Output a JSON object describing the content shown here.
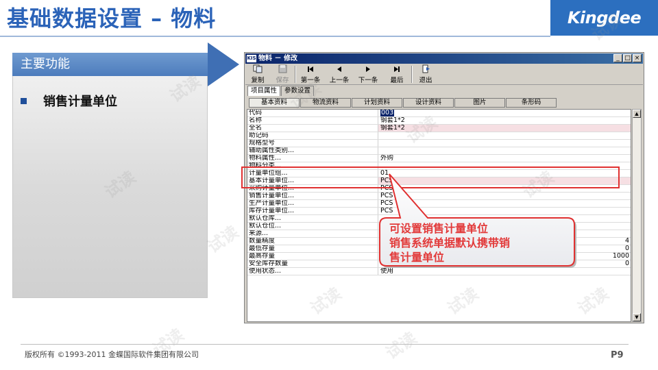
{
  "slide": {
    "title": "基础数据设置 – 物料",
    "logo": "Kingdee",
    "panel_heading": "主要功能",
    "bullet": "销售计量单位",
    "watermark": "试读",
    "copyright": "版权所有 ©1993-2011 金蝶国际软件集团有限公司",
    "page": "P9"
  },
  "window": {
    "app_icon": "KIS",
    "title": "物料 － 修改",
    "toolbar": [
      {
        "label": "复制",
        "icon": "copy-icon",
        "disabled": false
      },
      {
        "label": "保存",
        "icon": "save-icon",
        "disabled": true
      },
      {
        "label": "第一条",
        "icon": "first-record-icon",
        "disabled": false
      },
      {
        "label": "上一条",
        "icon": "previous-record-icon",
        "disabled": false
      },
      {
        "label": "下一条",
        "icon": "next-record-icon",
        "disabled": false
      },
      {
        "label": "最后",
        "icon": "last-record-icon",
        "disabled": false
      },
      {
        "label": "退出",
        "icon": "exit-icon",
        "disabled": false
      }
    ],
    "outer_tabs": [
      "项目属性",
      "参数设置"
    ],
    "inner_tabs": [
      "基本资料",
      "物流资料",
      "计划资料",
      "设计资料",
      "图片",
      "条形码"
    ],
    "rows": [
      {
        "label": "代码",
        "value": "003"
      },
      {
        "label": "名称",
        "value": "钢套1*2"
      },
      {
        "label": "全名",
        "value": "钢套1*2"
      },
      {
        "label": "助记码",
        "value": ""
      },
      {
        "label": "规格型号",
        "value": ""
      },
      {
        "label": "辅助属性类别...",
        "value": ""
      },
      {
        "label": "物料属性...",
        "value": "外购"
      },
      {
        "label": "物料分类...",
        "value": ""
      },
      {
        "label": "计量单位组...",
        "value": "01"
      },
      {
        "label": "基本计量单位...",
        "value": "PCS"
      },
      {
        "label": "采购计量单位...",
        "value": "PCS"
      },
      {
        "label": "销售计量单位...",
        "value": "PCS"
      },
      {
        "label": "生产计量单位...",
        "value": "PCS"
      },
      {
        "label": "库存计量单位...",
        "value": "PCS"
      },
      {
        "label": "默认仓库...",
        "value": ""
      },
      {
        "label": "默认仓位...",
        "value": ""
      },
      {
        "label": "来源...",
        "value": ""
      },
      {
        "label": "数量精度",
        "value": "4"
      },
      {
        "label": "最低存量",
        "value": "0"
      },
      {
        "label": "最高存量",
        "value": "1000"
      },
      {
        "label": "安全库存数量",
        "value": "0"
      },
      {
        "label": "使用状态...",
        "value": "使用"
      }
    ]
  },
  "callout": {
    "lines": [
      "可设置销售计量单位",
      "销售系统单据默认携带销",
      "售计量单位"
    ]
  },
  "colors": {
    "title_blue": "#2b63b8",
    "logo_bg": "#2c6fbf",
    "callout_red": "#e23a3a",
    "highlight_pink": "#f6dfe3"
  }
}
